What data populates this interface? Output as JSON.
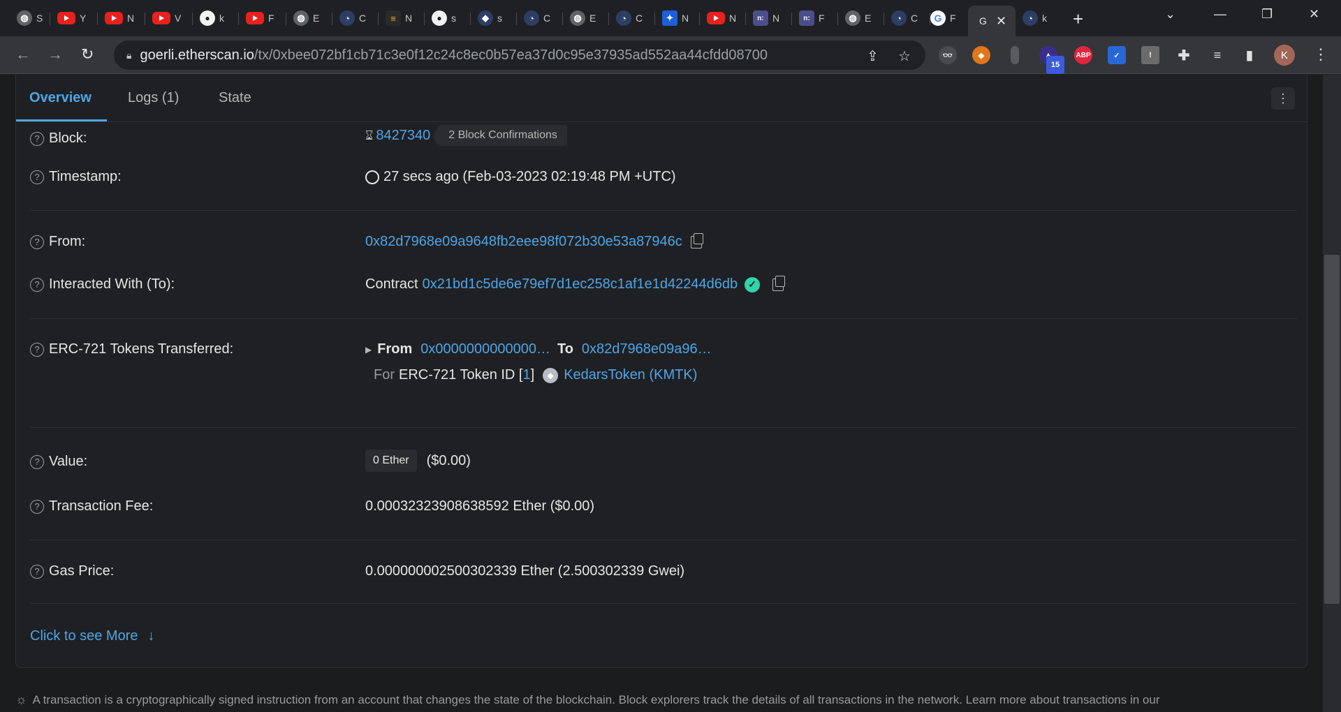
{
  "browser": {
    "tabs": [
      {
        "icon": "globe-icon",
        "label": "S"
      },
      {
        "icon": "youtube-icon",
        "label": "Y"
      },
      {
        "icon": "youtube-icon",
        "label": "N"
      },
      {
        "icon": "youtube-icon",
        "label": "V"
      },
      {
        "icon": "github-icon",
        "label": "k"
      },
      {
        "icon": "youtube-icon",
        "label": "F"
      },
      {
        "icon": "globe-icon",
        "label": "E"
      },
      {
        "icon": "etherscan-icon",
        "label": "C"
      },
      {
        "icon": "dapp-icon",
        "label": "N"
      },
      {
        "icon": "github-icon",
        "label": "s"
      },
      {
        "icon": "diamond-icon",
        "label": "s"
      },
      {
        "icon": "etherscan-icon",
        "label": "C"
      },
      {
        "icon": "globe-icon",
        "label": "E"
      },
      {
        "icon": "etherscan-icon",
        "label": "C"
      },
      {
        "icon": "blue-square-icon",
        "label": "N"
      },
      {
        "icon": "youtube-icon",
        "label": "N"
      },
      {
        "icon": "notion-like-icon",
        "label": "N"
      },
      {
        "icon": "notion-like-icon",
        "label": "F"
      },
      {
        "icon": "globe-icon",
        "label": "E"
      },
      {
        "icon": "etherscan-icon",
        "label": "C"
      },
      {
        "icon": "google-icon",
        "label": "F"
      },
      {
        "icon": "",
        "label": "G"
      },
      {
        "icon": "etherscan-icon",
        "label": "k"
      }
    ],
    "url_host": "goerli.etherscan.io",
    "url_path": "/tx/0xbee072bf1cb71c3e0f12c24c8ec0b57ea37d0c95e37935ad552aa44cfdd08700",
    "extension_badge": "15",
    "abp_label": "ABP",
    "avatar_letter": "K"
  },
  "page": {
    "tabs": [
      "Overview",
      "Logs (1)",
      "State"
    ],
    "block": {
      "label": "Block:",
      "number": "8427340",
      "confirmations": "2 Block Confirmations"
    },
    "timestamp": {
      "label": "Timestamp:",
      "value": "27 secs ago (Feb-03-2023 02:19:48 PM +UTC)"
    },
    "from": {
      "label": "From:",
      "address": "0x82d7968e09a9648fb2eee98f072b30e53a87946c"
    },
    "to": {
      "label": "Interacted With (To):",
      "prefix": "Contract",
      "address": "0x21bd1c5de6e79ef7d1ec258c1af1e1d42244d6db"
    },
    "erc721": {
      "label": "ERC-721 Tokens Transferred:",
      "from_word": "From",
      "from_addr": "0x0000000000000…",
      "to_word": "To",
      "to_addr": "0x82d7968e09a96…",
      "for_word": "For",
      "token_id_text": "ERC-721 Token ID [",
      "token_id": "1",
      "token_id_close": "]",
      "token_name": "KedarsToken (KMTK)"
    },
    "value": {
      "label": "Value:",
      "ether": "0 Ether",
      "usd": "($0.00)"
    },
    "fee": {
      "label": "Transaction Fee:",
      "value": "0.00032323908638592 Ether ($0.00)"
    },
    "gas": {
      "label": "Gas Price:",
      "value": "0.000000002500302339 Ether (2.500302339 Gwei)"
    },
    "more": "Click to see More",
    "footer": "A transaction is a cryptographically signed instruction from an account that changes the state of the blockchain. Block explorers track the details of all transactions in the network. Learn more about transactions in our"
  }
}
